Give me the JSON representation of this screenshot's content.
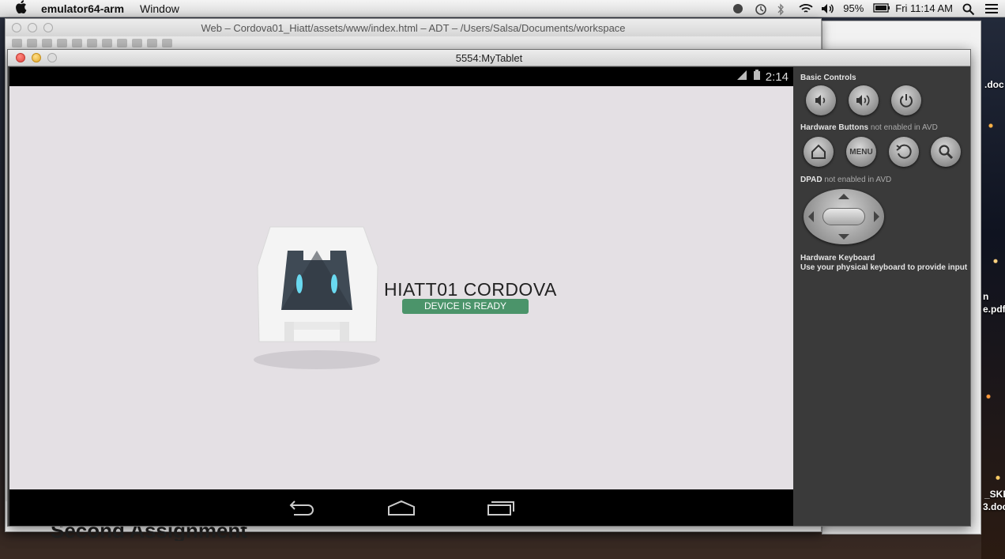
{
  "menubar": {
    "app_name": "emulator64-arm",
    "menu_window": "Window",
    "battery": "95%",
    "clock": "Fri 11:14 AM"
  },
  "adt": {
    "title": "Web – Cordova01_Hiatt/assets/www/index.html – ADT – /Users/Salsa/Documents/workspace",
    "heading": "Second Assignment"
  },
  "desktop": {
    "file1": ".doc",
    "file2": "n",
    "file3": "e.pdf",
    "file4": "_SKR",
    "file5": "3.doc"
  },
  "emulator": {
    "title": "5554:MyTablet",
    "status_time": "2:14",
    "app": {
      "title": "HIATT01 CORDOVA",
      "status": "DEVICE IS READY"
    },
    "controls": {
      "basic": "Basic Controls",
      "hardware": "Hardware Buttons",
      "hardware_note": "not enabled in AVD",
      "menu_label": "MENU",
      "dpad": "DPAD",
      "dpad_note": "not enabled in AVD",
      "keyboard_title": "Hardware Keyboard",
      "keyboard_text": "Use your physical keyboard to provide input"
    }
  }
}
